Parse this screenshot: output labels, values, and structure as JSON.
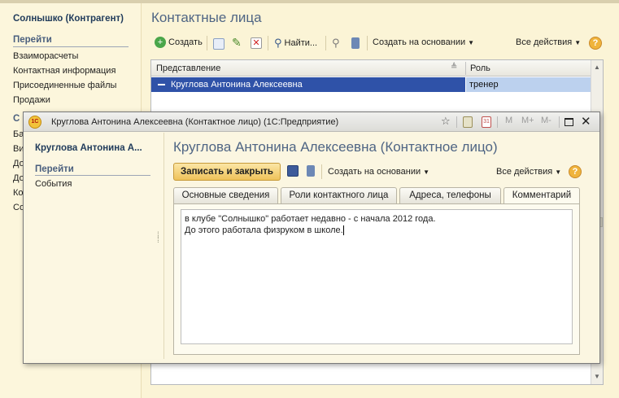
{
  "back": {
    "title": "Солнышко (Контрагент)",
    "nav_section": "Перейти",
    "nav_items": [
      "Взаиморасчеты",
      "Контактная информация",
      "Присоединенные файлы",
      "Продажи"
    ],
    "hidden_section_letter": "С",
    "hidden_items": [
      "Ба",
      "Ви",
      "До",
      "До",
      "Ко",
      "Со"
    ],
    "main_title": "Контактные лица",
    "toolbar": {
      "create": "Создать",
      "find": "Найти...",
      "create_based_on": "Создать на основании",
      "all_actions": "Все действия",
      "help": "?"
    },
    "table": {
      "columns": [
        "Представление",
        "Роль"
      ],
      "rows": [
        {
          "name": "Круглова Антонина Алексеевна",
          "role": "тренер"
        }
      ]
    }
  },
  "front": {
    "window_title": "Круглова Антонина Алексеевна (Контактное лицо)  (1С:Предприятие)",
    "app_icon": "1С",
    "title_buttons": [
      "M",
      "M+",
      "M-"
    ],
    "sidebar_title": "Круглова Антонина А...",
    "nav_section": "Перейти",
    "nav_items": [
      "События"
    ],
    "main_title": "Круглова Антонина Алексеевна (Контактное лицо)",
    "toolbar": {
      "save_close": "Записать и закрыть",
      "create_based_on": "Создать на основании",
      "all_actions": "Все действия",
      "help": "?"
    },
    "tabs": [
      "Основные сведения",
      "Роли контактного лица",
      "Адреса, телефоны",
      "Комментарий"
    ],
    "active_tab": "Комментарий",
    "comment_lines": [
      "в клубе \"Солнышко\" работает недавно - с начала 2012 года.",
      "До этого работала физруком в школе."
    ]
  },
  "colors": {
    "selection": "#2f52a8",
    "title_blue": "#4f6584",
    "background": "#fbf4d6"
  }
}
